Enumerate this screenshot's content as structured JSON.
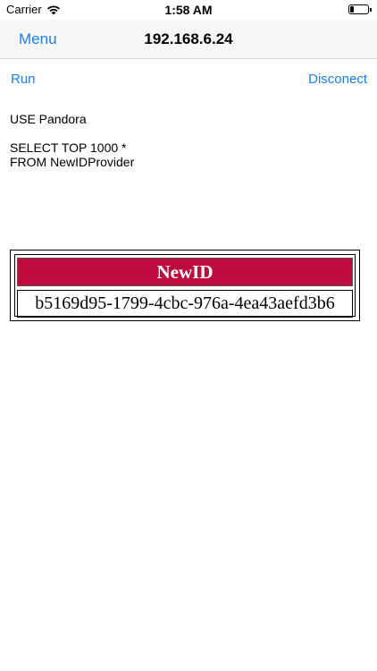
{
  "status_bar": {
    "carrier": "Carrier",
    "time": "1:58 AM",
    "wifi_icon": "wifi-icon",
    "battery_icon": "battery-icon",
    "battery_level": 0.2
  },
  "nav": {
    "back_label": "Menu",
    "title": "192.168.6.24"
  },
  "toolbar": {
    "run_label": "Run",
    "disconnect_label": "Disconect"
  },
  "query": {
    "lines": [
      "USE Pandora",
      "",
      "SELECT TOP 1000 *",
      "FROM NewIDProvider"
    ]
  },
  "results": {
    "columns": [
      "NewID"
    ],
    "rows": [
      [
        "b5169d95-1799-4cbc-976a-4ea43aefd3b6"
      ]
    ],
    "header_color": "#bf0a3e"
  },
  "colors": {
    "accent": "#1a7ef2"
  }
}
